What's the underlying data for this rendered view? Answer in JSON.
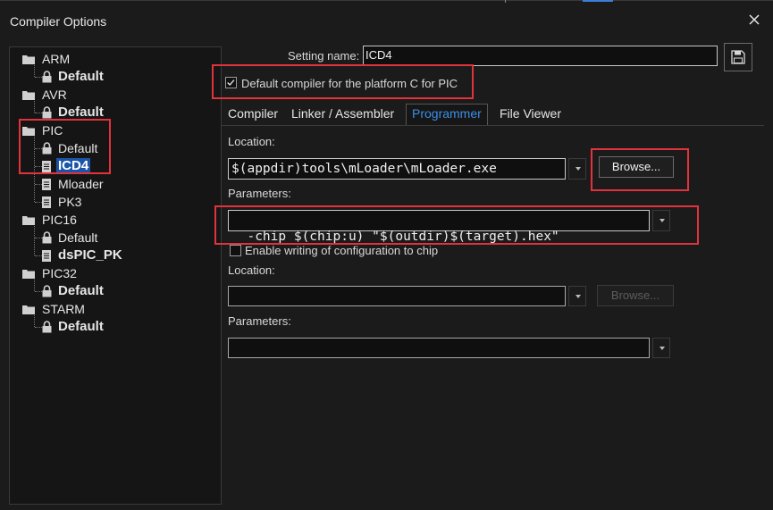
{
  "window": {
    "title": "Compiler Options"
  },
  "tree": {
    "groups": [
      {
        "label": "ARM",
        "children": [
          {
            "label": "Default",
            "bold": true,
            "icon": "lock-icon"
          }
        ]
      },
      {
        "label": "AVR",
        "children": [
          {
            "label": "Default",
            "bold": true,
            "icon": "lock-icon"
          }
        ]
      },
      {
        "label": "PIC",
        "children": [
          {
            "label": "Default",
            "bold": false,
            "icon": "lock-icon"
          },
          {
            "label": "ICD4",
            "bold": true,
            "icon": "document-icon",
            "selected": true
          },
          {
            "label": "Mloader",
            "bold": false,
            "icon": "document-icon"
          },
          {
            "label": "PK3",
            "bold": false,
            "icon": "document-icon"
          }
        ]
      },
      {
        "label": "PIC16",
        "children": [
          {
            "label": "Default",
            "bold": false,
            "icon": "lock-icon"
          },
          {
            "label": "dsPIC_PK",
            "bold": true,
            "icon": "document-icon"
          }
        ]
      },
      {
        "label": "PIC32",
        "children": [
          {
            "label": "Default",
            "bold": true,
            "icon": "lock-icon"
          }
        ]
      },
      {
        "label": "STARM",
        "children": [
          {
            "label": "Default",
            "bold": true,
            "icon": "lock-icon"
          }
        ]
      }
    ]
  },
  "setting": {
    "label": "Setting name:",
    "value": "ICD4"
  },
  "default_compiler": {
    "label": "Default compiler for the platform C for PIC",
    "checked": true
  },
  "tabs": [
    {
      "label": "Compiler",
      "active": false
    },
    {
      "label": "Linker / Assembler",
      "active": false
    },
    {
      "label": "Programmer",
      "active": true
    },
    {
      "label": "File Viewer",
      "active": false
    }
  ],
  "programmer": {
    "location_label": "Location:",
    "location_value": "$(appdir)tools\\mLoader\\mLoader.exe",
    "browse_label": "Browse...",
    "parameters_label": "Parameters:",
    "parameters_value": "-chip $(chip:u) \"$(outdir)$(target).hex\"",
    "enable_config_label": "Enable writing of configuration to chip",
    "enable_config_checked": false,
    "location2_label": "Location:",
    "location2_value": "",
    "browse2_label": "Browse...",
    "parameters2_label": "Parameters:",
    "parameters2_value": ""
  },
  "colors": {
    "highlight": "#e2333c",
    "selection": "#1c55a8",
    "active_tab": "#3c8fe6"
  }
}
